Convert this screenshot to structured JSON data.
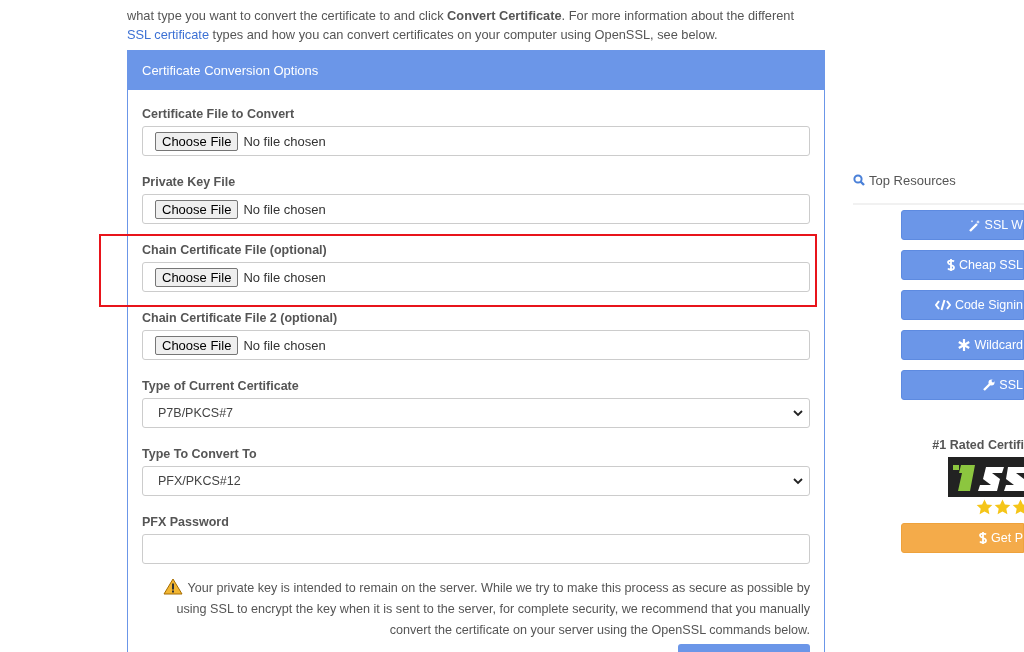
{
  "intro": {
    "line_1": "what type you want to convert the certificate to and click **Convert Certificate**. For more information about the different",
    "link": "SSL certificate",
    "line_2_rest": " types and how you can convert certificates on your computer using OpenSSL, see below."
  },
  "panel": {
    "title": "Certificate Conversion Options",
    "fields": [
      {
        "kind": "file",
        "label": "Certificate File to Convert",
        "button": "Choose File",
        "status": "No file chosen",
        "highlighted": false
      },
      {
        "kind": "file",
        "label": "Private Key File",
        "button": "Choose File",
        "status": "No file chosen",
        "highlighted": false
      },
      {
        "kind": "file",
        "label": "Chain Certificate File (optional)",
        "button": "Choose File",
        "status": "No file chosen",
        "highlighted": true
      },
      {
        "kind": "file",
        "label": "Chain Certificate File 2 (optional)",
        "button": "Choose File",
        "status": "No file chosen",
        "highlighted": false
      },
      {
        "kind": "select",
        "label": "Type of Current Certificate",
        "value": "P7B/PKCS#7"
      },
      {
        "kind": "select",
        "label": "Type To Convert To",
        "value": "PFX/PKCS#12"
      },
      {
        "kind": "password",
        "label": "PFX Password"
      }
    ],
    "warning": "Your private key is intended to remain on the server. While we try to make this process as secure as possible by using SSL to encrypt the key when it is sent to the server, for complete security, we recommend that you manually convert the certificate on your server using the OpenSSL commands below."
  },
  "sidebar": {
    "title": "Top Resources",
    "buttons": [
      {
        "kind": "wand",
        "label": "SSL W"
      },
      {
        "kind": "dollar",
        "label": "Cheap SSL"
      },
      {
        "kind": "code",
        "label": "Code Signin"
      },
      {
        "kind": "asterisk",
        "label": "Wildcard"
      },
      {
        "kind": "wrench",
        "label": "SSL"
      }
    ],
    "rated": "#1 Rated Certifi",
    "stars": 3,
    "cta": "Get P"
  }
}
